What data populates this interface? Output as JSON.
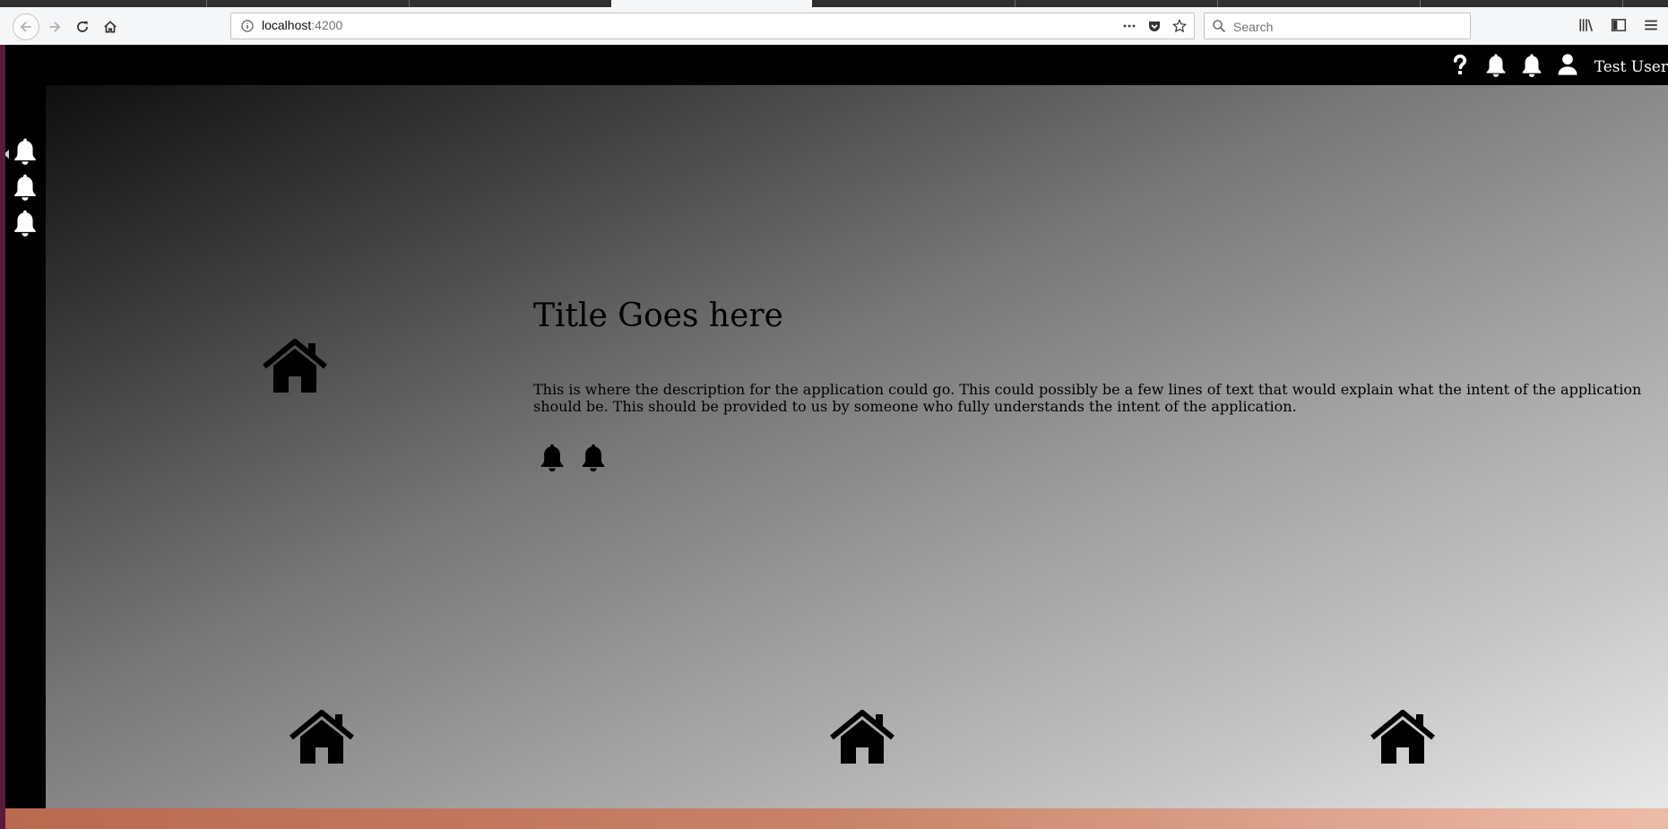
{
  "browser": {
    "url_host": "localhost",
    "url_port": ":4200",
    "search_placeholder": "Search"
  },
  "header": {
    "icons": [
      "help-icon",
      "bell-icon",
      "bell-icon",
      "user-icon"
    ],
    "user_name": "Test User"
  },
  "sidebar": {
    "icons": [
      "bell-icon",
      "bell-icon",
      "bell-icon"
    ]
  },
  "main": {
    "title": "Title Goes here",
    "description": "This is where the description for the application could go. This could possibly be a few lines of text that would explain what the intent of the application should be. This should be provided to us by someone who fully understands the intent of the application.",
    "action_icons": [
      "bell-icon",
      "bell-icon"
    ],
    "home_icons": [
      "home-icon",
      "home-icon",
      "home-icon",
      "home-icon"
    ]
  },
  "colors": {
    "header_bg": "#000000",
    "icon_white": "#ffffff",
    "icon_black": "#000000"
  }
}
